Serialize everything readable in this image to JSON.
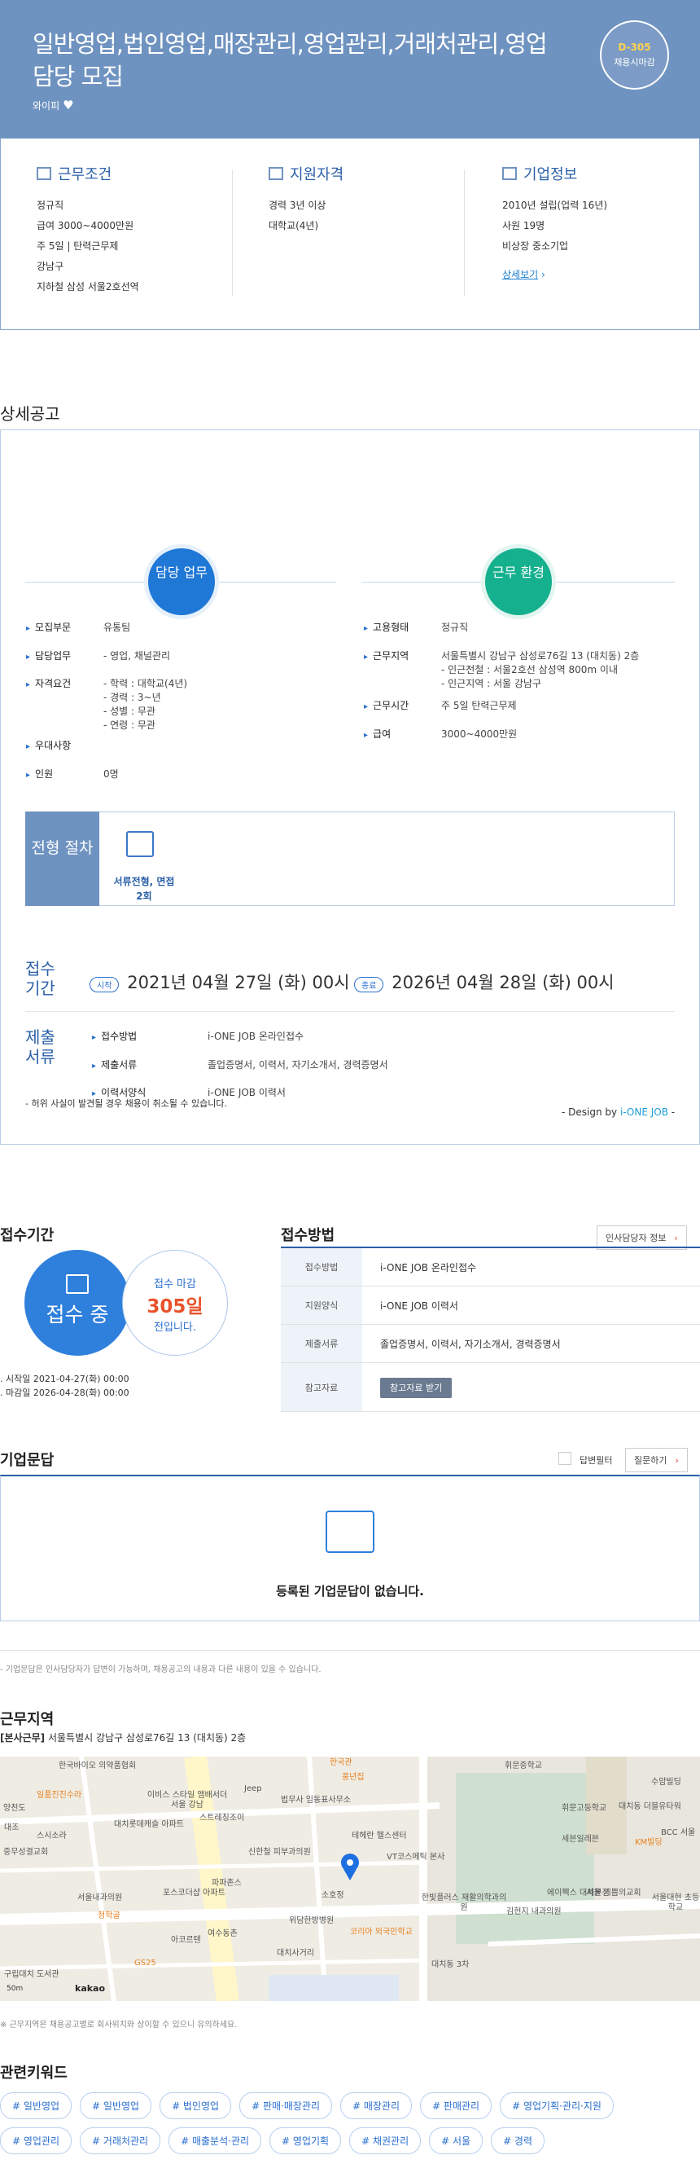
{
  "header": {
    "title": "일반영업,법인영업,매장관리,영업관리,거래처관리,영업담당 모집",
    "company": "와이피",
    "deadline_dday": "D-305",
    "deadline_text": "채용시마감"
  },
  "summary": {
    "work": {
      "title": "근무조건",
      "items": [
        "정규직",
        "급여 3000~4000만원",
        "주 5일 | 탄력근무제",
        "강남구",
        "지하철 삼성 서울2호선역"
      ]
    },
    "qual": {
      "title": "지원자격",
      "items": [
        "경력 3년 이상",
        "대학교(4년)"
      ]
    },
    "company": {
      "title": "기업정보",
      "items": [
        "2010년 설립(업력 16년)",
        "사원 19명",
        "비상장 중소기업"
      ],
      "link": "상세보기"
    }
  },
  "detail": {
    "section_title": "상세공고",
    "duty_circle": "담당 업무",
    "env_circle": "근무 환경",
    "left_rows": [
      {
        "k": "모집부문",
        "v": "유통팀"
      },
      {
        "k": "담당업무",
        "v": "- 영업, 채널관리"
      },
      {
        "k": "자격요건",
        "v": "- 학력 : 대학교(4년)\n- 경력 : 3~년\n- 성별 : 무관\n- 연령 : 무관"
      },
      {
        "k": "우대사항",
        "v": ""
      },
      {
        "k": "인원",
        "v": "0명"
      }
    ],
    "right_rows": [
      {
        "k": "고용형태",
        "v": "정규직"
      },
      {
        "k": "근무지역",
        "v": "서울특별시 강남구 삼성로76길 13 (대치동) 2층\n- 인근전철 : 서울2호선 삼성역 800m 이내\n- 인근지역 : 서울 강남구"
      },
      {
        "k": "근무시간",
        "v": "주 5일 탄력근무제"
      },
      {
        "k": "급여",
        "v": "3000~4000만원"
      }
    ],
    "process_label": "전형 절차",
    "process_step": "서류전형, 면접 2회",
    "period_label": "접수 기간",
    "start_pill": "시작",
    "start_date": "2021년 04월 27일 (화) 00시",
    "end_pill": "종료",
    "end_date": "2026년 04월 28일 (화) 00시",
    "docs_label": "제출 서류",
    "docs_rows": [
      {
        "k": "접수방법",
        "v": "i-ONE JOB 온라인접수"
      },
      {
        "k": "제출서류",
        "v": "졸업증명서, 이력서, 자기소개서, 경력증명서"
      },
      {
        "k": "이력서양식",
        "v": "i-ONE JOB 이력서"
      }
    ],
    "warning": "- 허위 사실이 발견될 경우 채용이 취소될 수 있습니다.",
    "design_prefix": "- Design by ",
    "design_brand": "i-ONE JOB",
    "design_suffix": " -"
  },
  "apply": {
    "period_title": "접수기간",
    "status": "접수 중",
    "deadline_pre": "접수 마감",
    "deadline_days": "305일",
    "deadline_post": "전입니다.",
    "start": "시작일 2021-04-27(화) 00:00",
    "end": "마감일 2026-04-28(화) 00:00",
    "method_title": "접수방법",
    "hr_button": "인사담당자 정보",
    "table": [
      {
        "th": "접수방법",
        "td": "i-ONE JOB 온라인접수"
      },
      {
        "th": "지원양식",
        "td": "i-ONE JOB 이력서"
      },
      {
        "th": "제출서류",
        "td": "졸업증명서, 이력서, 자기소개서, 경력증명서"
      },
      {
        "th": "참고자료",
        "td": "참고자료 받기"
      }
    ]
  },
  "qna": {
    "title": "기업문답",
    "answered_label": "답변필터",
    "ask_button": "질문하기",
    "empty": "등록된 기업문답이 없습니다.",
    "note": "- 기업문답은 인사담당자가 답변이 가능하며, 채용공고의 내용과 다른 내용이 있을 수 있습니다."
  },
  "location": {
    "title": "근무지역",
    "tag": "[본사근무]",
    "address": "서울특별시 강남구 삼성로76길 13 (대치동) 2층",
    "map_labels": [
      "한국바이오 의약품협회",
      "일품진진수라",
      "이비스 스타일 앰배서더 서울 강남",
      "Jeep",
      "법무사 임동표사무소",
      "대치롯데캐슬 아파트",
      "스트레칭조이",
      "테헤란 헬스센터",
      "VT코스메틱 본사",
      "신한철 피부과의원",
      "포스코더샵 아파트",
      "파파존스",
      "서울내과의원",
      "청학골",
      "소호정",
      "한빛플러스 재활의학과의원",
      "위담한방병원",
      "코리아 외국인학교",
      "여수동촌",
      "대치사거리",
      "대치동 3차",
      "휘문중학교",
      "휘문고등학교",
      "대치동 더블유타워",
      "BCC 서울",
      "KM빌딩",
      "세븐일레븐",
      "에이펙스 대치본점",
      "서울 기쁨의교회",
      "김현지 내과의원",
      "서울대현 초등학교",
      "수암빌딩",
      "아코르텐",
      "GS25",
      "한국관",
      "풍년집",
      "구립대치 도서관",
      "대조",
      "스시소라",
      "중무성결교회",
      "양천도"
    ],
    "map_scale": "50m",
    "map_logo": "kakao",
    "note": "※ 근무지역은 채용공고별로 회사위치와 상이할 수 있으니 유의하세요."
  },
  "keywords": {
    "title": "관련키워드",
    "items": [
      "# 일반영업",
      "# 일반영업",
      "# 법인영업",
      "# 판매·매장관리",
      "# 매장관리",
      "# 판매관리",
      "# 영업기획·관리·지원",
      "# 영업관리",
      "# 거래처관리",
      "# 매출분석·관리",
      "# 영업기획",
      "# 채권관리",
      "# 서울",
      "# 경력"
    ]
  },
  "colors": {
    "header_bg": "#6f93c0",
    "accent_blue": "#1f77d6",
    "accent_green": "#15b08e",
    "deadline_red": "#e8532b"
  }
}
